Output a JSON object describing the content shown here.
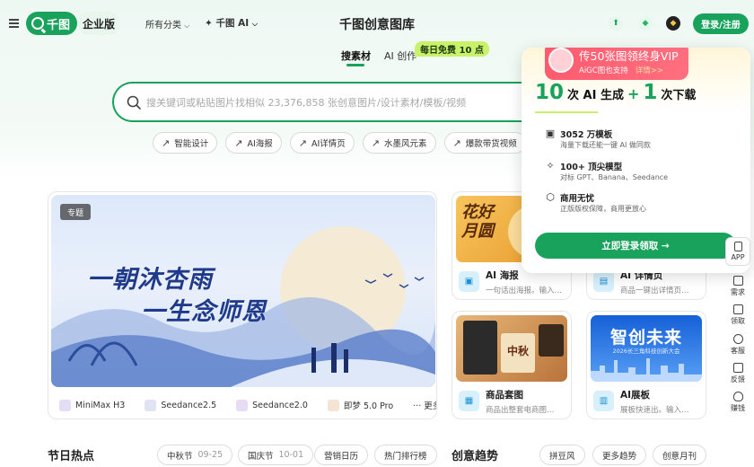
{
  "header": {
    "logo_text": "千图",
    "enterprise_label": "企业版",
    "nav_category": "所有分类",
    "nav_ai": "✦ 千图 AI",
    "site_title": "千图创意图库",
    "login_label": "登录/注册"
  },
  "tabs": {
    "materials": "搜素材",
    "ai_create": "AI 创作",
    "free_badge": "每日免费 10 点"
  },
  "search": {
    "placeholder": "搜关键词或粘贴图片找相似 23,376,858 张创意图片/设计素材/模板/视频"
  },
  "chips": [
    "智能设计",
    "AI海报",
    "AI详情页",
    "水墨风元素",
    "爆款带货视频"
  ],
  "promo": {
    "vip_title": "传50张图领终身VIP",
    "vip_sub": "AiGC图也支持",
    "vip_detail": "详情>>",
    "gen_count": "10",
    "gen_label": "次 AI 生成",
    "plus": "+",
    "dl_count": "1",
    "dl_label": "次下载",
    "features": [
      {
        "title": "3052 万模板",
        "desc": "海量下载还能一键 AI 做同款",
        "icon": "image-icon"
      },
      {
        "title": "100+ 顶尖模型",
        "desc": "对标 GPT、Banana、Seedance",
        "icon": "sparkle-icon"
      },
      {
        "title": "商用无忧",
        "desc": "正版版权保障，商用更放心",
        "icon": "shield-icon"
      }
    ],
    "cta": "立即登录领取 →"
  },
  "rail": [
    {
      "label": "APP",
      "icon": "phone-icon"
    },
    {
      "label": "需求",
      "icon": "clipboard-icon"
    },
    {
      "label": "领取",
      "icon": "gift-icon"
    },
    {
      "label": "客服",
      "icon": "headset-icon"
    },
    {
      "label": "反馈",
      "icon": "feedback-icon"
    },
    {
      "label": "赚钱",
      "icon": "moneybag-icon"
    }
  ],
  "hero": {
    "tag": "专题",
    "line1": "一朝沐杏雨",
    "line2": "一生念师恩",
    "models": [
      "MiniMax H3",
      "Seedance2.5",
      "Seedance2.0",
      "即梦 5.0 Pro"
    ],
    "more": "··· 更多"
  },
  "cards": [
    {
      "title": "AI 海报",
      "desc": "一句话出海报。输入…",
      "art": "花好月圆"
    },
    {
      "title": "AI 详情页",
      "desc": "商品一键出详情页…",
      "art": ""
    },
    {
      "title": "商品套图",
      "desc": "商品出整套电商图…",
      "art": "中秋"
    },
    {
      "title": "AI展板",
      "desc": "展板快速出。输入…",
      "art": "智创未来"
    }
  ],
  "card_art_sub": "2026长三角科技创新大会",
  "bottom": {
    "festival_title": "节日热点",
    "festivals": [
      {
        "name": "中秋节",
        "date": "09-25"
      },
      {
        "name": "国庆节",
        "date": "10-01"
      },
      {
        "name": "营销日历",
        "date": ""
      },
      {
        "name": "热门排行榜",
        "date": ""
      }
    ],
    "trend_title": "创意趋势",
    "trends": [
      "拼豆风",
      "更多趋势",
      "创意月刊"
    ]
  },
  "colors": {
    "brand": "#19a25c",
    "lime": "#c9f169",
    "vip": "#ff5b6e"
  }
}
